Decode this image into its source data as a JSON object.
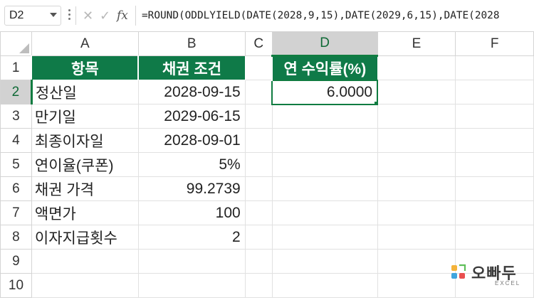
{
  "formula_bar": {
    "name_box": "D2",
    "fx_label": "fx",
    "cancel_icon": "✕",
    "enter_icon": "✓",
    "formula": "=ROUND(ODDLYIELD(DATE(2028,9,15),DATE(2029,6,15),DATE(2028"
  },
  "columns": [
    "A",
    "B",
    "C",
    "D",
    "E",
    "F"
  ],
  "rows": [
    "1",
    "2",
    "3",
    "4",
    "5",
    "6",
    "7",
    "8",
    "9",
    "10"
  ],
  "cells": {
    "A1": "항목",
    "B1": "채권 조건",
    "D1": "연 수익률(%)",
    "A2": "정산일",
    "B2": "2028-09-15",
    "D2": "6.0000",
    "A3": "만기일",
    "B3": "2029-06-15",
    "A4": "최종이자일",
    "B4": "2028-09-01",
    "A5": "연이율(쿠폰)",
    "B5": "5%",
    "A6": "채권 가격",
    "B6": "99.2739",
    "A7": "액면가",
    "B7": "100",
    "A8": "이자지급횟수",
    "B8": "2"
  },
  "selection": {
    "active_cell": "D2",
    "active_column": "D",
    "active_row": "2"
  },
  "logo": {
    "text": "오빠두",
    "sub": "EXCEL"
  },
  "colors": {
    "header_fill": "#0f7a48",
    "selection": "#107c41"
  }
}
